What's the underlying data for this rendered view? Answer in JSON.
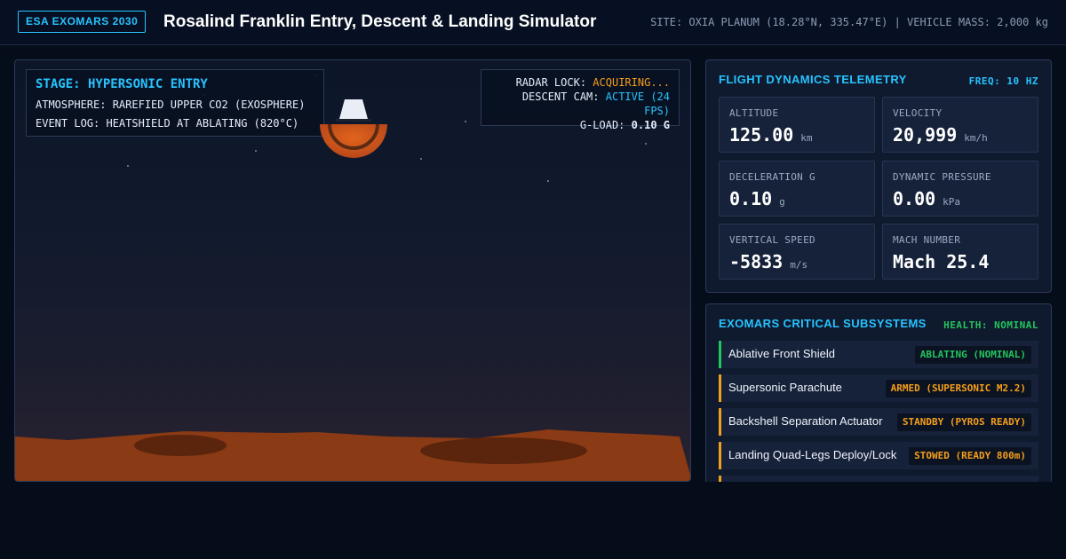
{
  "header": {
    "badge": "ESA EXOMARS 2030",
    "title": "Rosalind Franklin Entry, Descent & Landing Simulator",
    "site_info": "SITE: OXIA PLANUM (18.28°N, 335.47°E) | VEHICLE MASS: 2,000 kg"
  },
  "viewport": {
    "stage": "STAGE: HYPERSONIC ENTRY",
    "atmosphere": "ATMOSPHERE: RAREFIED UPPER CO2 (EXOSPHERE)",
    "event_log": "EVENT LOG: HEATSHIELD AT ABLATING (820°C)",
    "radar_label": "RADAR LOCK:",
    "radar_value": "ACQUIRING...",
    "cam_label": "DESCENT CAM:",
    "cam_value": "ACTIVE (24 FPS)",
    "gload_label": "G-LOAD:",
    "gload_value": "0.10 G"
  },
  "telemetry": {
    "title": "FLIGHT DYNAMICS TELEMETRY",
    "freq": "FREQ: 10 HZ",
    "metrics": [
      {
        "label": "ALTITUDE",
        "value": "125.00",
        "unit": "km"
      },
      {
        "label": "VELOCITY",
        "value": "20,999",
        "unit": "km/h"
      },
      {
        "label": "DECELERATION G",
        "value": "0.10",
        "unit": "g"
      },
      {
        "label": "DYNAMIC PRESSURE",
        "value": "0.00",
        "unit": "kPa"
      },
      {
        "label": "VERTICAL SPEED",
        "value": "-5833",
        "unit": "m/s"
      },
      {
        "label": "MACH NUMBER",
        "value": "Mach 25.4",
        "unit": ""
      }
    ]
  },
  "subsystems": {
    "title": "EXOMARS CRITICAL SUBSYSTEMS",
    "health": "HEALTH: NOMINAL",
    "items": [
      {
        "name": "Ablative Front Shield",
        "status": "ABLATING (NOMINAL)"
      },
      {
        "name": "Supersonic Parachute",
        "status": "ARMED (SUPERSONIC M2.2)"
      },
      {
        "name": "Backshell Separation Actuator",
        "status": "STANDBY (PYROS READY)"
      },
      {
        "name": "Landing Quad-Legs Deploy/Lock",
        "status": "STOWED (READY 800m)"
      }
    ]
  },
  "colors": {
    "accent": "#27c3ff",
    "warning": "#f59e1b",
    "nominal": "#22c55e",
    "terrain": "#8a3a14"
  }
}
